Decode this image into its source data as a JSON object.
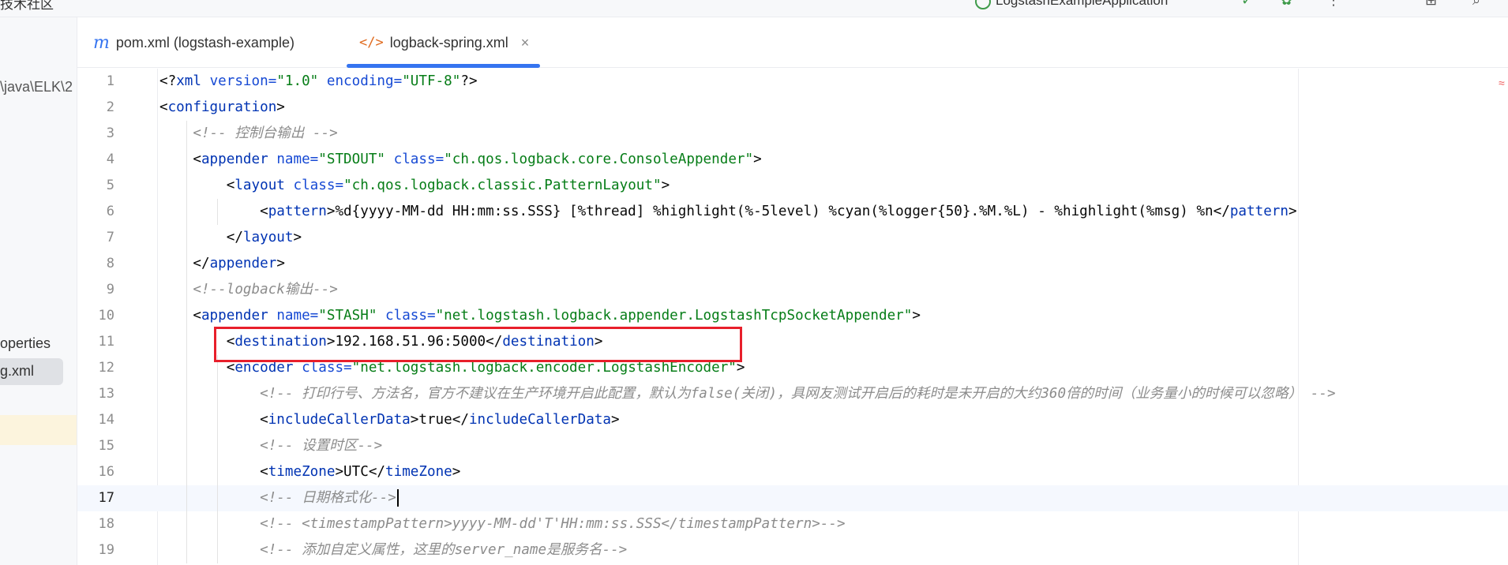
{
  "topbar": {
    "left_text": "技术社区",
    "run_config": "LogstashExampleApplication"
  },
  "project": {
    "path_fragment": "\\java\\ELK\\2",
    "item_props": "operties",
    "item_selected": "g.xml"
  },
  "tabs": [
    {
      "icon": "m",
      "label": "pom.xml (logstash-example)"
    },
    {
      "icon": "</>",
      "label": "logback-spring.xml",
      "close": "×"
    }
  ],
  "editor": {
    "current_line": 17,
    "lines": [
      {
        "n": "1",
        "segs": [
          [
            "p",
            "<?"
          ],
          [
            "t",
            "xml "
          ],
          [
            "a",
            "version="
          ],
          [
            "s",
            "\"1.0\""
          ],
          [
            "p",
            " "
          ],
          [
            "a",
            "encoding="
          ],
          [
            "s",
            "\"UTF-8\""
          ],
          [
            "p",
            "?>"
          ]
        ]
      },
      {
        "n": "2",
        "segs": [
          [
            "p",
            "<"
          ],
          [
            "t",
            "configuration"
          ],
          [
            "p",
            ">"
          ]
        ]
      },
      {
        "n": "3",
        "segs": [
          [
            "p",
            "    "
          ],
          [
            "c",
            "<!-- 控制台输出 -->"
          ]
        ]
      },
      {
        "n": "4",
        "segs": [
          [
            "p",
            "    <"
          ],
          [
            "t",
            "appender "
          ],
          [
            "a",
            "name="
          ],
          [
            "s",
            "\"STDOUT\""
          ],
          [
            "p",
            " "
          ],
          [
            "a",
            "class="
          ],
          [
            "s",
            "\"ch.qos.logback.core.ConsoleAppender\""
          ],
          [
            "p",
            ">"
          ]
        ]
      },
      {
        "n": "5",
        "segs": [
          [
            "p",
            "        <"
          ],
          [
            "t",
            "layout "
          ],
          [
            "a",
            "class="
          ],
          [
            "s",
            "\"ch.qos.logback.classic.PatternLayout\""
          ],
          [
            "p",
            ">"
          ]
        ]
      },
      {
        "n": "6",
        "segs": [
          [
            "p",
            "            <"
          ],
          [
            "t",
            "pattern"
          ],
          [
            "p",
            ">%d{yyyy-MM-dd HH:mm:ss.SSS} [%thread] %highlight(%-5level) %cyan(%logger{50}.%M.%L) - %highlight(%msg) %n</"
          ],
          [
            "t",
            "pattern"
          ],
          [
            "p",
            ">"
          ]
        ]
      },
      {
        "n": "7",
        "segs": [
          [
            "p",
            "        </"
          ],
          [
            "t",
            "layout"
          ],
          [
            "p",
            ">"
          ]
        ]
      },
      {
        "n": "8",
        "segs": [
          [
            "p",
            "    </"
          ],
          [
            "t",
            "appender"
          ],
          [
            "p",
            ">"
          ]
        ]
      },
      {
        "n": "9",
        "segs": [
          [
            "p",
            "    "
          ],
          [
            "c",
            "<!--logback输出-->"
          ]
        ]
      },
      {
        "n": "10",
        "segs": [
          [
            "p",
            "    <"
          ],
          [
            "t",
            "appender "
          ],
          [
            "a",
            "name="
          ],
          [
            "s",
            "\"STASH\""
          ],
          [
            "p",
            " "
          ],
          [
            "a",
            "class="
          ],
          [
            "s",
            "\"net.logstash.logback.appender.LogstashTcpSocketAppender\""
          ],
          [
            "p",
            ">"
          ]
        ]
      },
      {
        "n": "11",
        "segs": [
          [
            "p",
            "        <"
          ],
          [
            "t",
            "destination"
          ],
          [
            "p",
            ">192.168.51.96:5000</"
          ],
          [
            "t",
            "destination"
          ],
          [
            "p",
            ">"
          ]
        ]
      },
      {
        "n": "12",
        "segs": [
          [
            "p",
            "        <"
          ],
          [
            "t",
            "encoder "
          ],
          [
            "a",
            "class="
          ],
          [
            "s",
            "\"net.logstash.logback.encoder.LogstashEncoder\""
          ],
          [
            "p",
            ">"
          ]
        ]
      },
      {
        "n": "13",
        "segs": [
          [
            "p",
            "            "
          ],
          [
            "c",
            "<!-- 打印行号、方法名，官方不建议在生产环境开启此配置，默认为false(关闭)，具网友测试开启后的耗时是未开启的大约360倍的时间（业务量小的时候可以忽略） -->"
          ]
        ]
      },
      {
        "n": "14",
        "segs": [
          [
            "p",
            "            <"
          ],
          [
            "t",
            "includeCallerData"
          ],
          [
            "p",
            ">true</"
          ],
          [
            "t",
            "includeCallerData"
          ],
          [
            "p",
            ">"
          ]
        ]
      },
      {
        "n": "15",
        "segs": [
          [
            "p",
            "            "
          ],
          [
            "c",
            "<!-- 设置时区-->"
          ]
        ]
      },
      {
        "n": "16",
        "segs": [
          [
            "p",
            "            <"
          ],
          [
            "t",
            "timeZone"
          ],
          [
            "p",
            ">UTC</"
          ],
          [
            "t",
            "timeZone"
          ],
          [
            "p",
            ">"
          ]
        ]
      },
      {
        "n": "17",
        "segs": [
          [
            "p",
            "            "
          ],
          [
            "c",
            "<!-- 日期格式化-->"
          ]
        ]
      },
      {
        "n": "18",
        "segs": [
          [
            "p",
            "            "
          ],
          [
            "c",
            "<!-- <timestampPattern>yyyy-MM-dd'T'HH:mm:ss.SSS</timestampPattern>-->"
          ]
        ]
      },
      {
        "n": "19",
        "segs": [
          [
            "p",
            "            "
          ],
          [
            "c",
            "<!-- 添加自定义属性，这里的server_name是服务名-->"
          ]
        ]
      }
    ]
  }
}
